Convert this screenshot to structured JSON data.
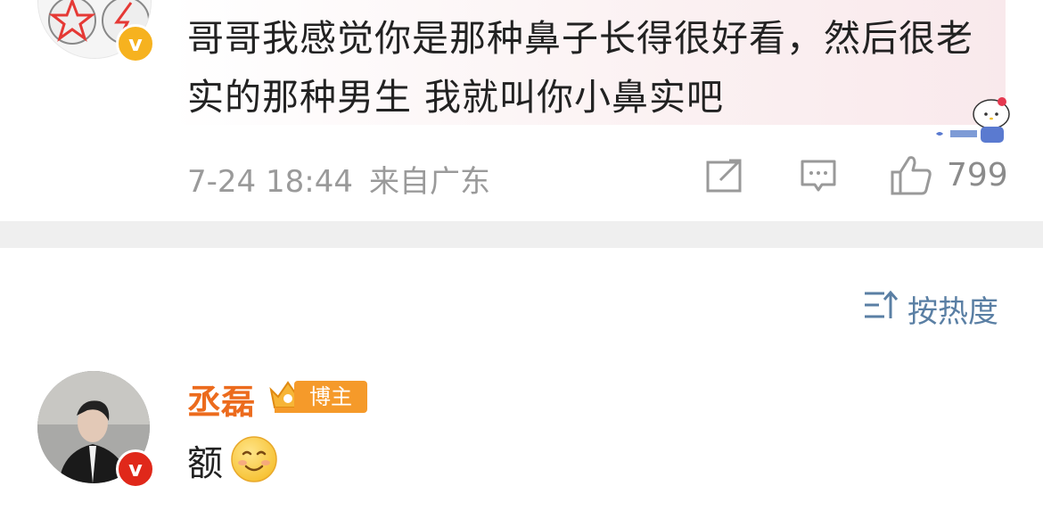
{
  "top_comment": {
    "text": "哥哥我感觉你是那种鼻子长得很好看，然后很老实的那种男生 我就叫你小鼻实吧",
    "time": "7-24 18:44",
    "location": "来自广东",
    "likes": "799",
    "icons": [
      "share-icon",
      "comment-icon",
      "like-icon"
    ]
  },
  "sort": {
    "label": "按热度"
  },
  "reply_comment": {
    "username": "丞磊",
    "badge": "博主",
    "text": "额"
  },
  "colors": {
    "username": "#ec6b1d",
    "sort": "#5a7fa4",
    "meta": "#9a9a9a",
    "divider": "#efefef",
    "v_badge_gold": "#f6b21f",
    "v_badge_red": "#e0281a"
  }
}
